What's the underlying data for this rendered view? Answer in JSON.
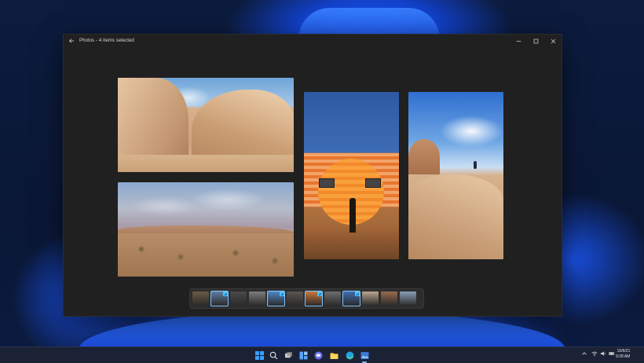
{
  "window": {
    "title": "Photos - 4 items selected",
    "controls": [
      "minimize",
      "maximize",
      "close"
    ]
  },
  "photos": [
    {
      "name": "desert-boulders-hiker"
    },
    {
      "name": "joshua-tree-landscape"
    },
    {
      "name": "orange-sun-mural"
    },
    {
      "name": "rock-slope-hiker"
    }
  ],
  "filmstrip": {
    "thumbnails": [
      {
        "selected": false,
        "color": "#6b5a44"
      },
      {
        "selected": true,
        "color": "#5d7fa3"
      },
      {
        "selected": false,
        "color": "#4a4a4a"
      },
      {
        "selected": false,
        "color": "#7d7d7d"
      },
      {
        "selected": true,
        "color": "#4f86c6"
      },
      {
        "selected": false,
        "color": "#5a5650"
      },
      {
        "selected": true,
        "color": "#c9773a"
      },
      {
        "selected": false,
        "color": "#6e6e6e"
      },
      {
        "selected": true,
        "color": "#3f6db0"
      },
      {
        "selected": false,
        "color": "#b9a58f"
      },
      {
        "selected": false,
        "color": "#9a6a4c"
      },
      {
        "selected": false,
        "color": "#8c9fb8"
      }
    ]
  },
  "taskbar": {
    "icons": [
      "windows-start-icon",
      "search-icon",
      "task-view-icon",
      "widgets-icon",
      "chat-icon",
      "file-explorer-icon",
      "edge-browser-icon",
      "photos-app-icon"
    ]
  },
  "tray": {
    "time": "9:28 AM",
    "date": "10/6/21"
  },
  "colors": {
    "accent": "#4cc2ff",
    "window_bg": "#202020"
  }
}
